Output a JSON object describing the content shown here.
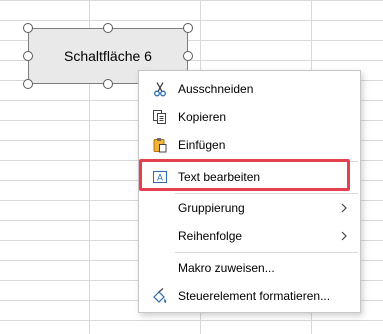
{
  "shape": {
    "label": "Schaltfläche 6"
  },
  "context_menu": {
    "items": [
      {
        "id": "cut",
        "label": "Ausschneiden",
        "icon": "scissors-icon",
        "has_submenu": false
      },
      {
        "id": "copy",
        "label": "Kopieren",
        "icon": "copy-icon",
        "has_submenu": false
      },
      {
        "id": "paste",
        "label": "Einfügen",
        "icon": "paste-icon",
        "has_submenu": false
      },
      {
        "id": "edit-text",
        "label": "Text bearbeiten",
        "icon": "edit-text-icon",
        "has_submenu": false,
        "highlighted": true
      },
      {
        "id": "grouping",
        "label": "Gruppierung",
        "icon": "",
        "has_submenu": true
      },
      {
        "id": "order",
        "label": "Reihenfolge",
        "icon": "",
        "has_submenu": true
      },
      {
        "id": "assign-macro",
        "label": "Makro zuweisen...",
        "icon": "",
        "has_submenu": false
      },
      {
        "id": "format-control",
        "label": "Steuerelement formatieren...",
        "icon": "format-control-icon",
        "has_submenu": false
      }
    ],
    "submenu_arrow": "chevron-right-icon"
  },
  "colors": {
    "highlight_border": "#e5414c",
    "shape_fill": "#e9e9e9",
    "gridline": "#d9d9d9",
    "icon_blue": "#2b6cb5",
    "icon_orange": "#d98c1a"
  }
}
